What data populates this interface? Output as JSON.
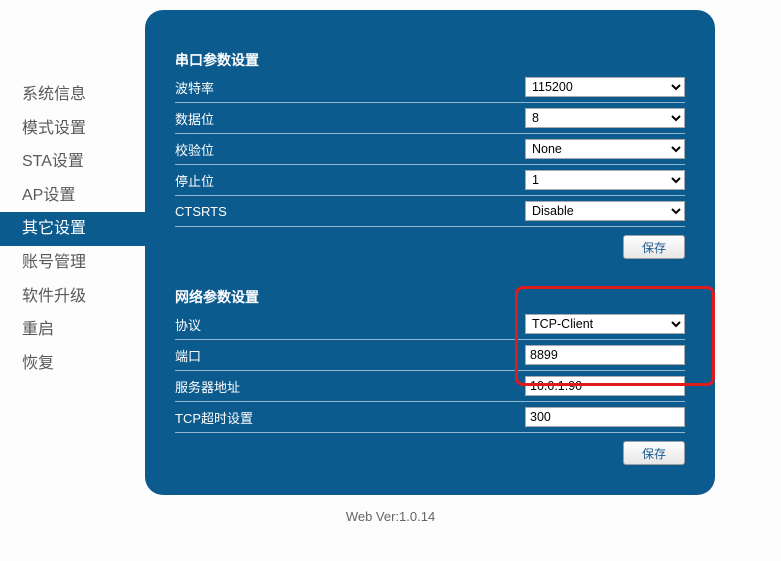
{
  "sidebar": {
    "items": [
      {
        "label": "系统信息"
      },
      {
        "label": "模式设置"
      },
      {
        "label": "STA设置"
      },
      {
        "label": "AP设置"
      },
      {
        "label": "其它设置"
      },
      {
        "label": "账号管理"
      },
      {
        "label": "软件升级"
      },
      {
        "label": "重启"
      },
      {
        "label": "恢复"
      }
    ]
  },
  "serial": {
    "title": "串口参数设置",
    "baud_label": "波特率",
    "baud_value": "115200",
    "databits_label": "数据位",
    "databits_value": "8",
    "parity_label": "校验位",
    "parity_value": "None",
    "stopbits_label": "停止位",
    "stopbits_value": "1",
    "ctsrts_label": "CTSRTS",
    "ctsrts_value": "Disable",
    "save_label": "保存"
  },
  "network": {
    "title": "网络参数设置",
    "protocol_label": "协议",
    "protocol_value": "TCP-Client",
    "port_label": "端口",
    "port_value": "8899",
    "server_label": "服务器地址",
    "server_value": "10.0.1.90",
    "timeout_label": "TCP超时设置",
    "timeout_value": "300",
    "save_label": "保存"
  },
  "footer": {
    "version": "Web Ver:1.0.14"
  }
}
